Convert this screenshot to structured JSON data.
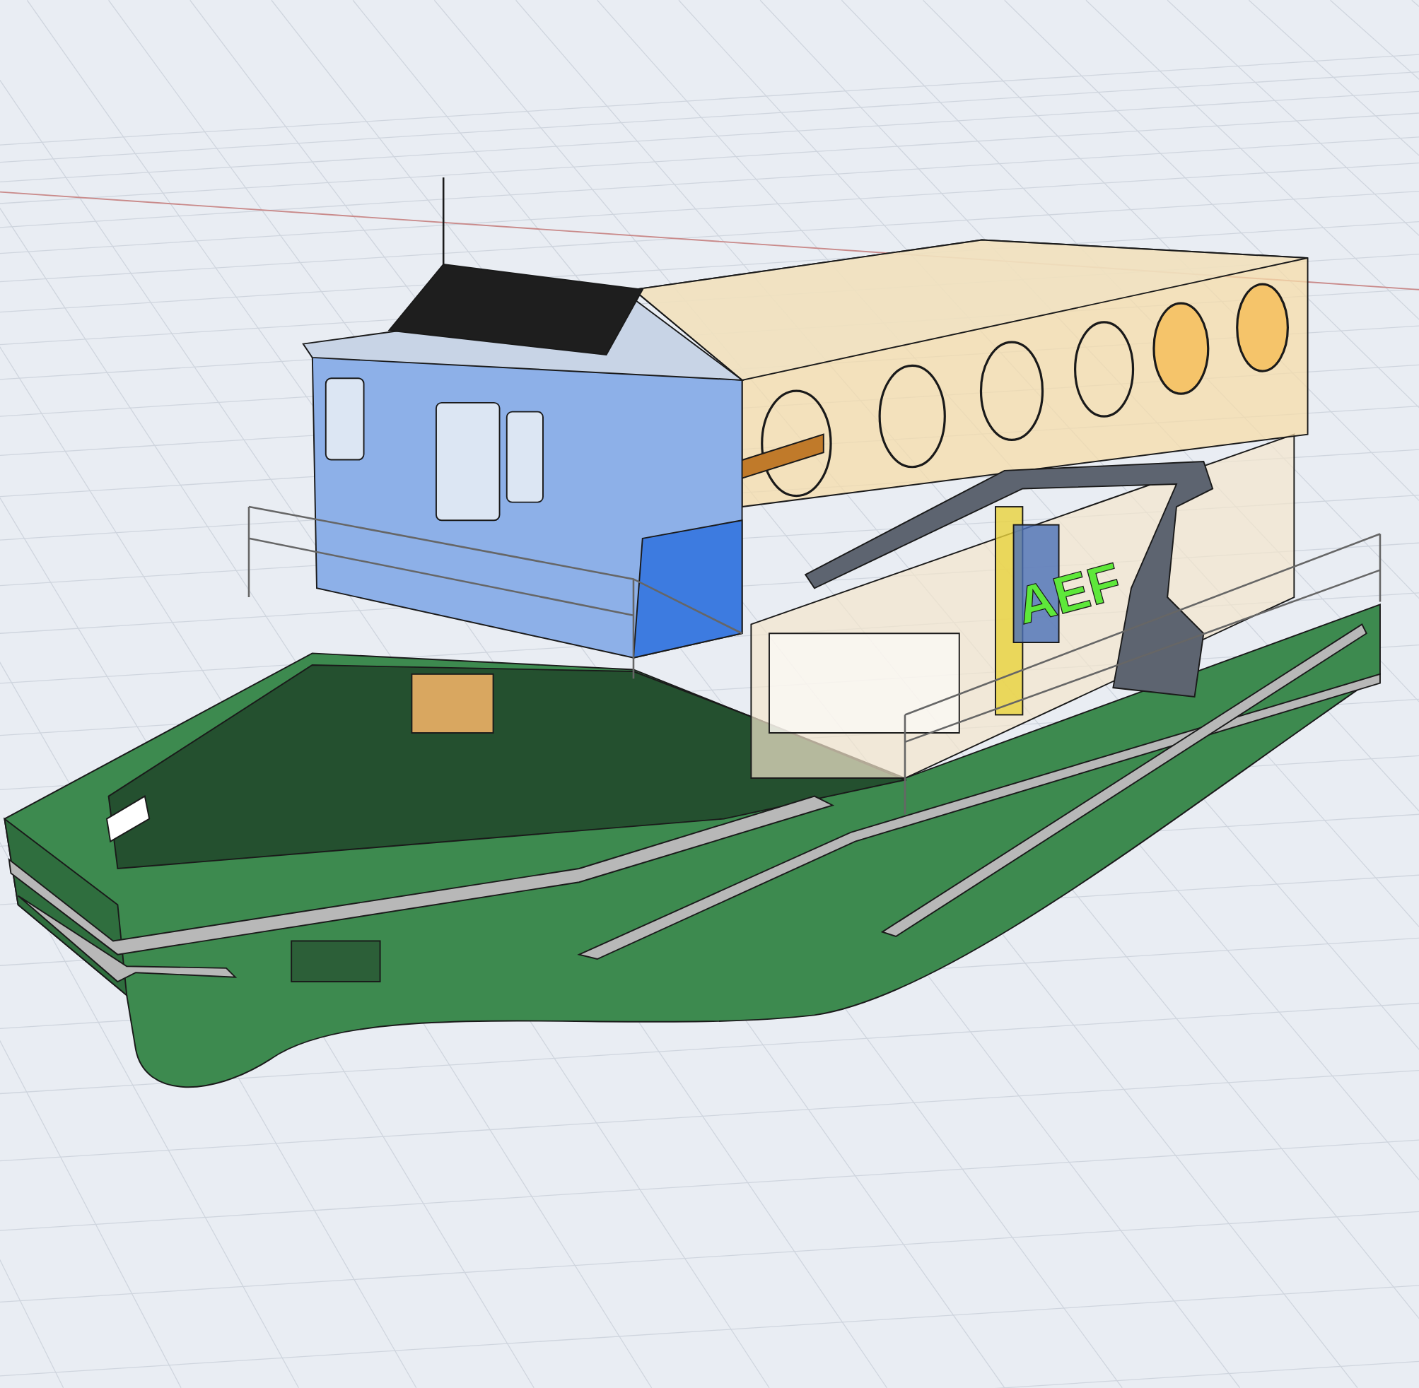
{
  "viewport": {
    "sign_text": "AEF"
  }
}
